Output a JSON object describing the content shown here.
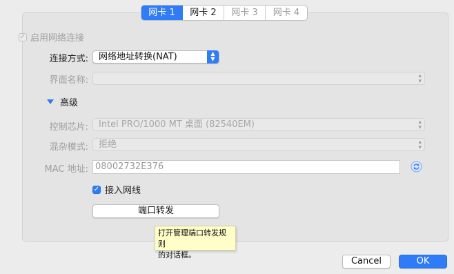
{
  "tabs": [
    "网卡 1",
    "网卡 2",
    "网卡 3",
    "网卡 4"
  ],
  "enable_adapter": {
    "label": "启用网络连接",
    "checked": true,
    "disabled": true
  },
  "attached_to": {
    "label": "连接方式:",
    "value": "网络地址转换(NAT)"
  },
  "name": {
    "label": "界面名称:",
    "value": ""
  },
  "advanced": {
    "label": "高级",
    "expanded": true
  },
  "adapter_type": {
    "label": "控制芯片:",
    "value": "Intel PRO/1000 MT 桌面 (82540EM)"
  },
  "promiscuous_mode": {
    "label": "混杂模式:",
    "value": "拒绝"
  },
  "mac_address": {
    "label": "MAC 地址:",
    "value": "08002732E376"
  },
  "cable_connected": {
    "label": "接入网线",
    "checked": true
  },
  "port_forwarding": {
    "label": "端口转发"
  },
  "tooltip": {
    "line1": "打开管理端口转发规则",
    "line2": "的对话框。"
  },
  "footer": {
    "cancel": "Cancel",
    "ok": "OK"
  },
  "icons": {
    "check": "check-icon",
    "triangle": "disclosure-triangle-icon",
    "refresh": "refresh-icon",
    "chevrons": "up-down-chevron-icon"
  },
  "colors": {
    "accent": "#2f7cf6",
    "tooltip_bg": "#fffdc8"
  }
}
